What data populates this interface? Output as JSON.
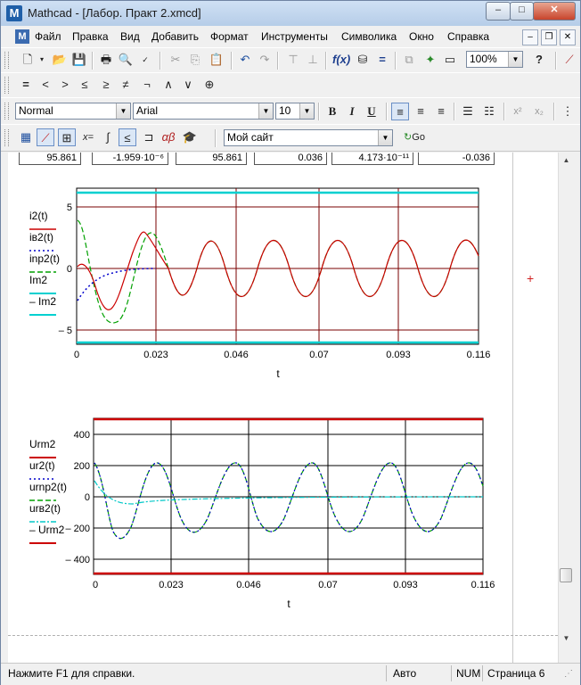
{
  "window": {
    "title": "Mathcad - [Лабор. Практ 2.xmcd]",
    "app_icon": "M",
    "controls": [
      "–",
      "□",
      "✕"
    ],
    "doc_controls": [
      "–",
      "❐",
      "✕"
    ]
  },
  "menu": [
    "Файл",
    "Правка",
    "Вид",
    "Добавить",
    "Формат",
    "Инструменты",
    "Символика",
    "Окно",
    "Справка"
  ],
  "toolbar": {
    "zoom_value": "100%"
  },
  "operators": [
    "=",
    "<",
    ">",
    "≤",
    "≥",
    "≠",
    "¬",
    "∧",
    "∨",
    "⊕"
  ],
  "format_bar": {
    "style": "Normal",
    "font": "Arial",
    "size": "10",
    "bold": "B",
    "italic": "I",
    "underline": "U"
  },
  "resources": {
    "site": "Мой сайт",
    "go_label": "Go"
  },
  "top_values": [
    "95.861",
    "-1.959·10⁻⁶",
    "95.861",
    "0.036",
    "4.173·10⁻¹¹",
    "-0.036"
  ],
  "plot1": {
    "legend": [
      "i2(t)",
      "iв2(t)",
      "inp2(t)",
      "Im2",
      "– Im2"
    ],
    "yticks": [
      "5",
      "0",
      "– 5"
    ],
    "xticks": [
      "0",
      "0.023",
      "0.046",
      "0.07",
      "0.093",
      "0.116"
    ],
    "xlabel": "t",
    "colors": {
      "i2": "#cc0000",
      "iv2": "#0000cc",
      "inp2": "#00a000",
      "im2": "#00d0d0"
    }
  },
  "plot2": {
    "legend": [
      "Urm2",
      "ur2(t)",
      "urnp2(t)",
      "urв2(t)",
      "– Urm2"
    ],
    "yticks": [
      "400",
      "200",
      "0",
      "– 200",
      "– 400"
    ],
    "xticks": [
      "0",
      "0.023",
      "0.046",
      "0.07",
      "0.093",
      "0.116"
    ],
    "xlabel": "t",
    "colors": {
      "urm2": "#cc0000",
      "ur2": "#0000cc",
      "urnp2": "#00a000",
      "urv2": "#00c8c8"
    }
  },
  "status": {
    "help": "Нажмите F1 для справки.",
    "mode": "Авто",
    "num": "NUM",
    "page": "Страница 6"
  }
}
